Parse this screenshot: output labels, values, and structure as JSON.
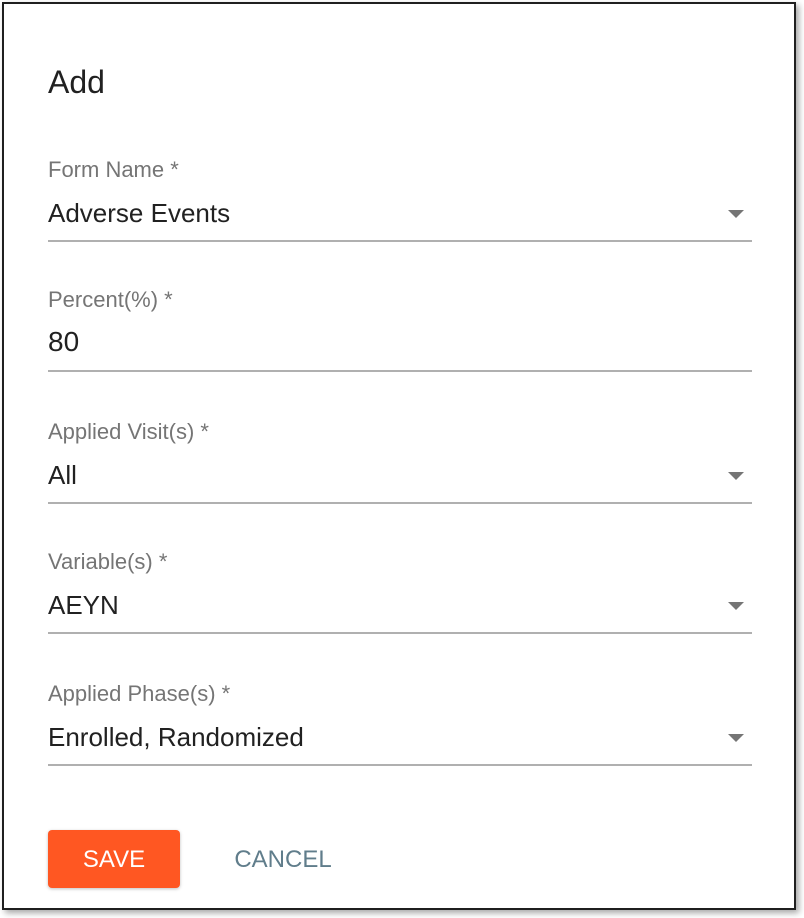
{
  "dialog": {
    "title": "Add"
  },
  "fields": {
    "form_name": {
      "label": "Form Name *",
      "value": "Adverse Events"
    },
    "percent": {
      "label": "Percent(%) *",
      "value": "80"
    },
    "applied_visits": {
      "label": "Applied Visit(s) *",
      "value": "All"
    },
    "variables": {
      "label": "Variable(s) *",
      "value": "AEYN"
    },
    "applied_phases": {
      "label": "Applied Phase(s) *",
      "value": "Enrolled, Randomized"
    }
  },
  "actions": {
    "save_label": "SAVE",
    "cancel_label": "CANCEL"
  },
  "colors": {
    "save_button": "#ff5722",
    "cancel_text": "#607d8b",
    "label_text": "#757575",
    "value_text": "#212121",
    "underline": "#b0b0b0"
  },
  "icons": {
    "dropdown": "caret-down-icon"
  }
}
